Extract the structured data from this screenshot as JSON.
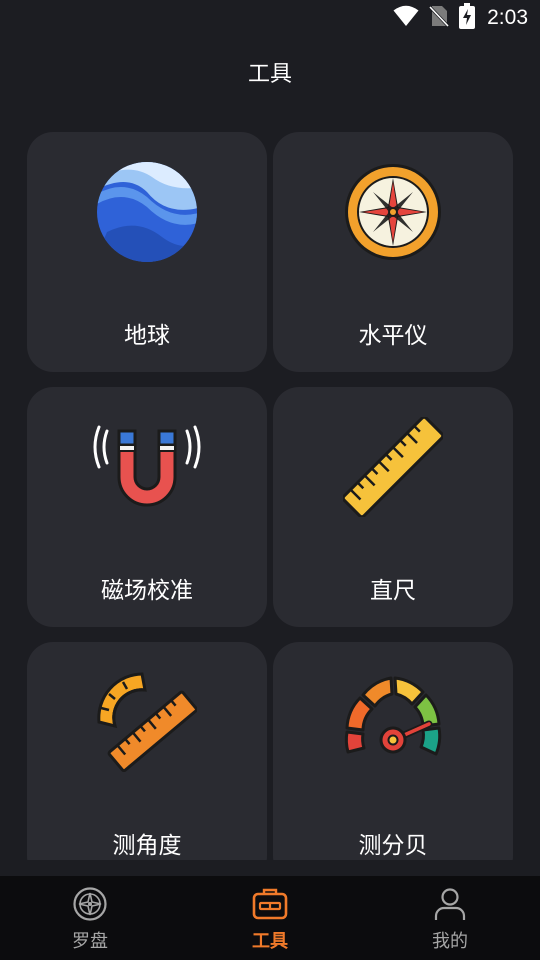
{
  "status_bar": {
    "time": "2:03"
  },
  "header": {
    "title": "工具"
  },
  "tools": [
    {
      "label": "地球",
      "icon": "globe-icon"
    },
    {
      "label": "水平仪",
      "icon": "compass-icon"
    },
    {
      "label": "磁场校准",
      "icon": "magnet-icon"
    },
    {
      "label": "直尺",
      "icon": "ruler-icon"
    },
    {
      "label": "测角度",
      "icon": "protractor-icon"
    },
    {
      "label": "测分贝",
      "icon": "gauge-icon"
    }
  ],
  "bottom_nav": {
    "items": [
      {
        "label": "罗盘",
        "icon": "compass-outline-icon",
        "active": false
      },
      {
        "label": "工具",
        "icon": "toolbox-icon",
        "active": true
      },
      {
        "label": "我的",
        "icon": "user-icon",
        "active": false
      }
    ]
  },
  "colors": {
    "background": "#1c1d22",
    "card": "#2a2b31",
    "nav_background": "#0c0c0e",
    "accent": "#f07a2a",
    "nav_inactive": "#a6a6a6"
  }
}
